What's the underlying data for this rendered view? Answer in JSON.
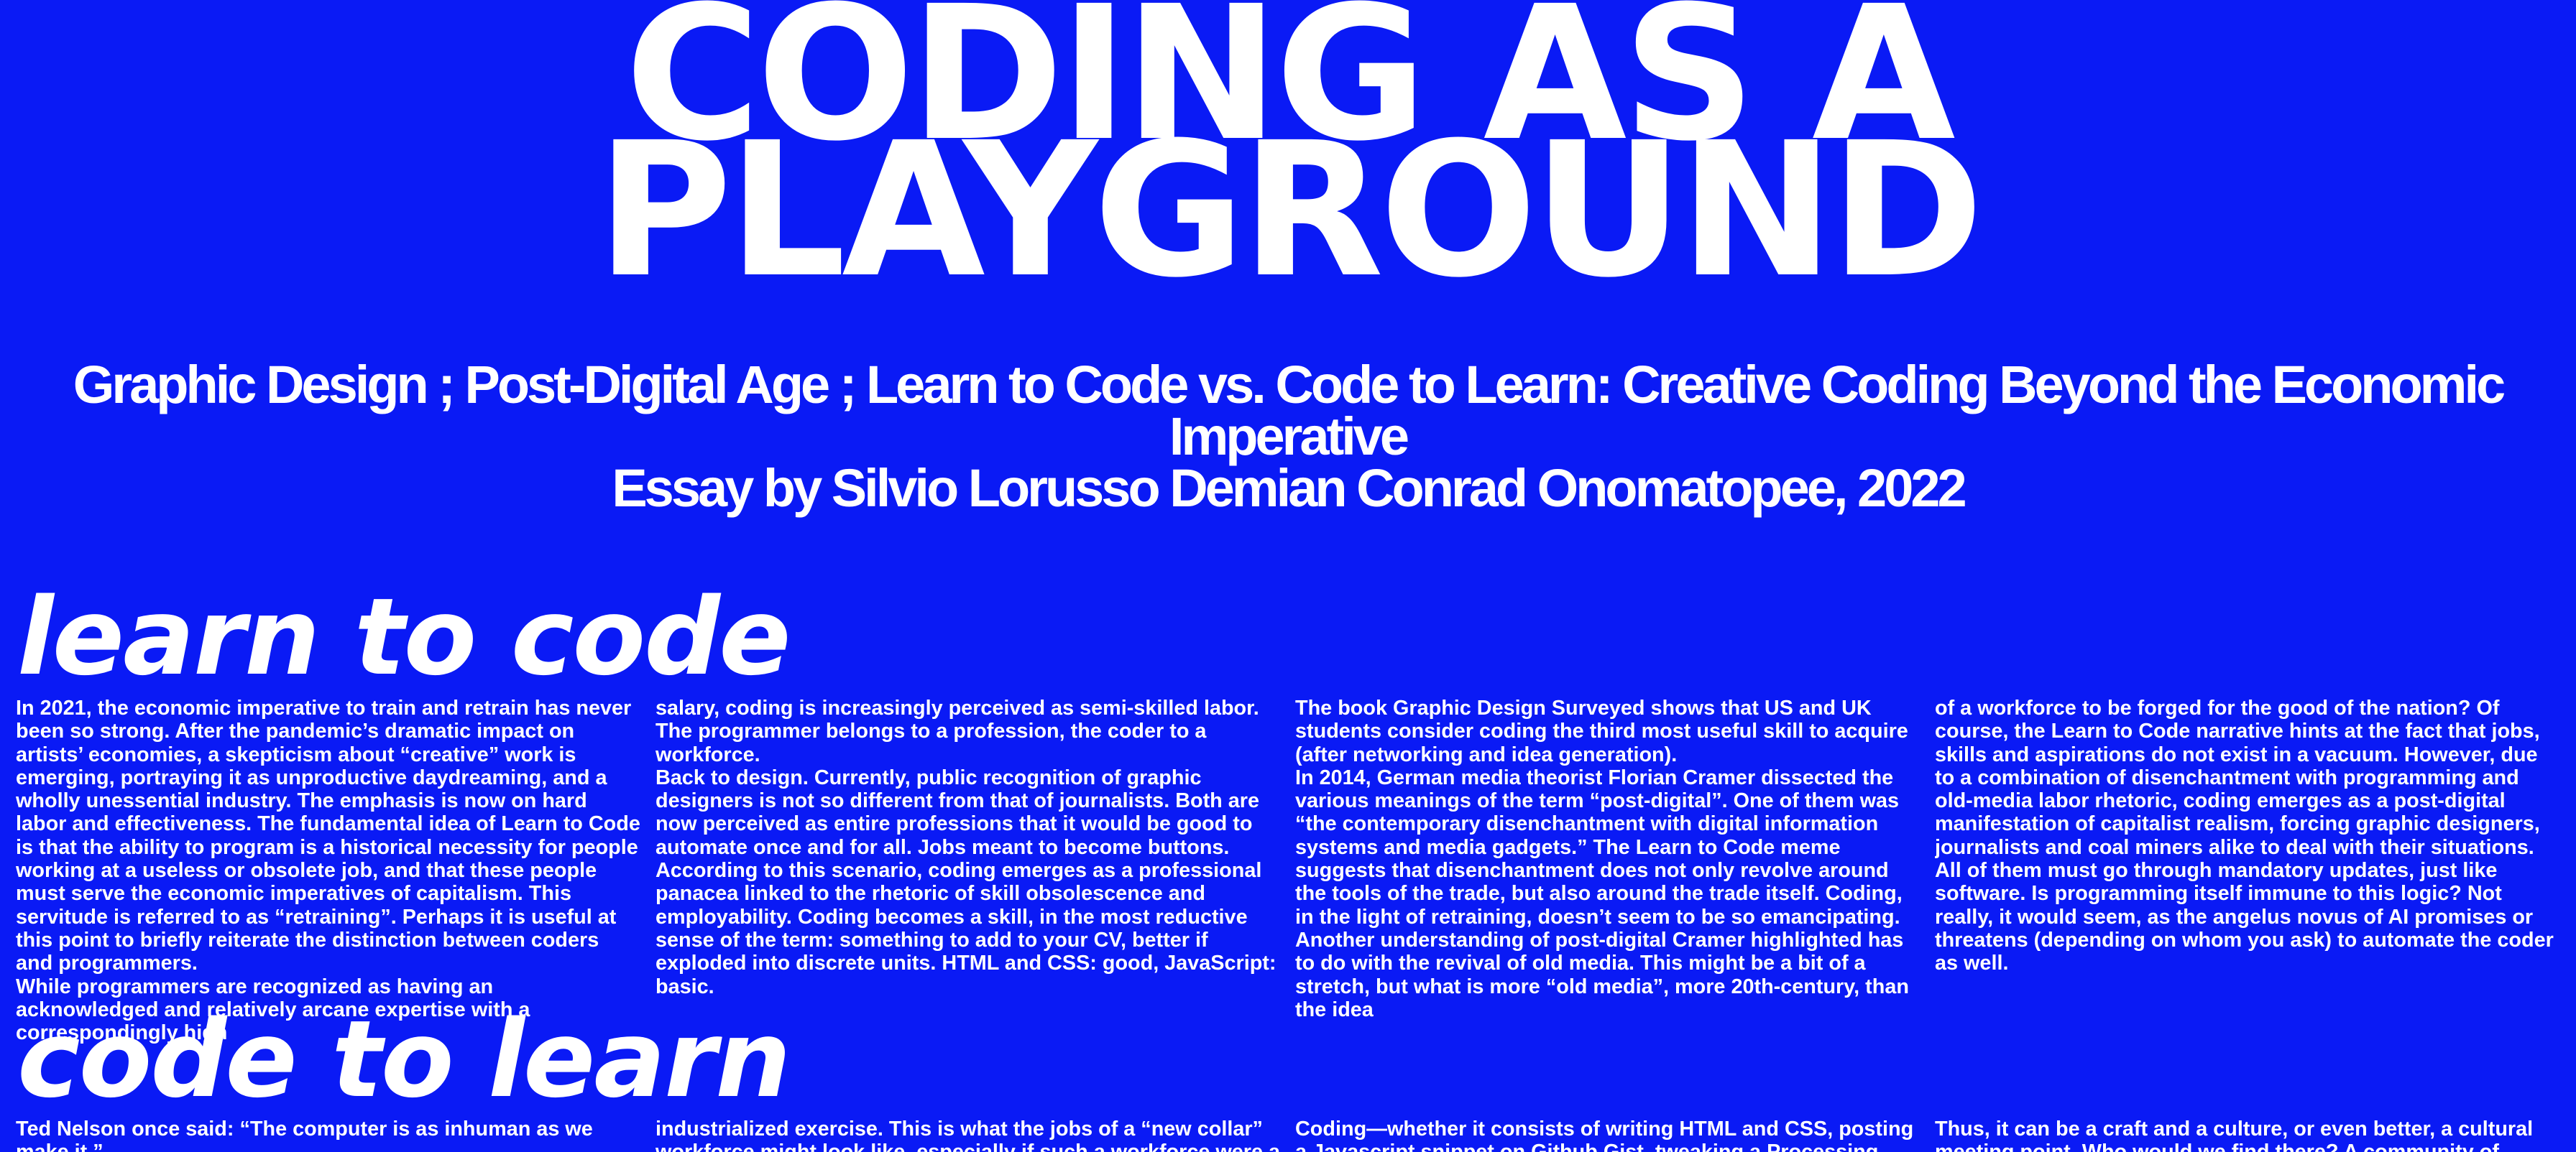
{
  "header": {
    "title_line1": "CODING AS A",
    "title_line2": "PLAYGROUND",
    "subtitle_line1": "Graphic Design ; Post-Digital Age ; Learn to Code vs. Code to Learn: Creative Coding Beyond the Economic",
    "subtitle_line2": "Imperative",
    "subtitle_line3": "Essay by Silvio Lorusso Demian Conrad Onomatopee, 2022"
  },
  "section1": {
    "heading": "learn to code",
    "col1": [
      "In 2021, the economic imperative to train and retrain has never been so strong. After the pandemic’s dramatic impact on artists’ economies, a skepticism about “creative” work is emerging, portraying it as unproductive daydreaming, and a wholly unessential industry. The emphasis is now on hard labor and effectiveness. The fundamental idea of Learn to Code is that the ability to program is a historical necessity for people working at a useless or obsolete job, and that these people must serve the economic imperatives of capitalism. This servitude is referred to as “retraining”. Perhaps it is useful at this point to briefly reiterate the distinction between coders and programmers.",
      "While programmers are recognized as having an acknowledged and relatively arcane expertise with a correspondingly high"
    ],
    "col2": [
      "salary, coding is increasingly perceived as semi-skilled labor. The programmer belongs to a profession, the coder to a workforce.",
      "Back to design. Currently, public recognition of graphic designers is not so different from that of journalists. Both are now perceived as entire professions that it would be good to automate once and for all. Jobs meant to become buttons. According to this scenario, coding emerges as a professional panacea linked to the rhetoric of skill obsolescence and employability. Coding becomes a skill, in the most reductive sense of the term: something to add to your CV, better if exploded into discrete units. HTML and CSS: good, JavaScript: basic."
    ],
    "col3": [
      "The book Graphic Design Surveyed shows that US and UK students consider coding the third most useful skill to acquire (after networking and idea generation).",
      "In 2014, German media theorist Florian Cramer dissected the various meanings of the term “post-digital”. One of them was “the contemporary disenchantment with digital information systems and media gadgets.” The Learn to Code meme suggests that disenchantment does not only revolve around the tools of the trade, but also around the trade itself. Coding, in the light of retraining, doesn’t seem to be so emancipating.",
      "Another understanding of post-digital Cramer highlighted has to do with the revival of old media. This might be a bit of a stretch, but what is more “old media”, more 20th-century, than the idea"
    ],
    "col4": [
      "of a workforce to be forged for the good of the nation? Of course, the Learn to Code narrative hints at the fact that jobs, skills and aspirations do not exist in a vacuum. However, due to a combination of disenchantment with programming and old-media labor rhetoric, coding emerges as a post-digital manifestation of capitalist realism, forcing graphic designers, journalists and coal miners alike to deal with their situations. All of them must go through mandatory updates, just like software. Is programming itself immune to this logic? Not really, it would seem, as the angelus novus of AI promises or threatens (depending on whom you ask) to automate the coder as well."
    ]
  },
  "section2": {
    "heading": "code to learn",
    "col1": [
      "Ted Nelson once said: “The computer is as inhuman as we make it.”"
    ],
    "col2": [
      "industrialized exercise. This is what the jobs of a “new collar” workforce might look like, especially if such a workforce were a"
    ],
    "col3": [
      "Coding—whether it consists of writing HTML and CSS, posting a Javascript snippet on Github Gist, tweaking a Processing"
    ],
    "col4": [
      "Thus, it can be a craft and a culture, or even better, a cultural meeting point. Who would we find there? A community of"
    ]
  }
}
